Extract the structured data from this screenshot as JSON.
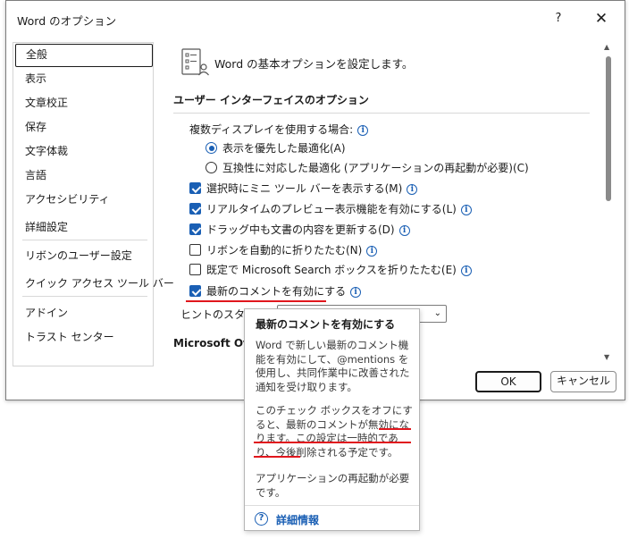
{
  "window": {
    "title": "Word のオプション",
    "help_label": "?",
    "close_label": "✕"
  },
  "sidebar": {
    "items": [
      {
        "label": "全般"
      },
      {
        "label": "表示"
      },
      {
        "label": "文章校正"
      },
      {
        "label": "保存"
      },
      {
        "label": "文字体裁"
      },
      {
        "label": "言語"
      },
      {
        "label": "アクセシビリティ"
      },
      {
        "label": "詳細設定"
      },
      {
        "label": "リボンのユーザー設定"
      },
      {
        "label": "クイック アクセス ツール バー"
      },
      {
        "label": "アドイン"
      },
      {
        "label": "トラスト センター"
      }
    ]
  },
  "content": {
    "header": "Word の基本オプションを設定します。",
    "section1_title": "ユーザー インターフェイスのオプション",
    "multi_display_label": "複数ディスプレイを使用する場合:",
    "radio_appearance": "表示を優先した最適化(A)",
    "radio_compat": "互換性に対応した最適化 (アプリケーションの再起動が必要)(C)",
    "opt_minitoolbar": "選択時にミニ ツール バーを表示する(M)",
    "opt_live_preview": "リアルタイムのプレビュー表示機能を有効にする(L)",
    "opt_drag_update": "ドラッグ中も文書の内容を更新する(D)",
    "opt_ribbon_collapse": "リボンを自動的に折りたたむ(N)",
    "opt_search_collapse": "既定で Microsoft Search ボックスを折りたたむ(E)",
    "opt_modern_comments": "最新のコメントを有効にする",
    "hint_style_label": "ヒントのスタイル",
    "hint_style_value": "",
    "section2_title": "Microsoft Of"
  },
  "buttons": {
    "ok": "OK",
    "cancel": "キャンセル"
  },
  "tooltip": {
    "title": "最新のコメントを有効にする",
    "para1": "Word で新しい最新のコメント機能を有効にして、@mentions を使用し、共同作業中に改善された通知を受け取ります。",
    "para2": "このチェック ボックスをオフにすると、最新のコメントが無効になります。この設定は一時的であり、今後削除される予定です。",
    "para3": "アプリケーションの再起動が必要です。",
    "link": "詳細情報"
  },
  "colors": {
    "accent": "#1a5fb4",
    "annotation": "#e0161d"
  },
  "icons": {
    "header": "options-list-person-icon",
    "info": "info-icon",
    "help": "help-circle-icon"
  }
}
